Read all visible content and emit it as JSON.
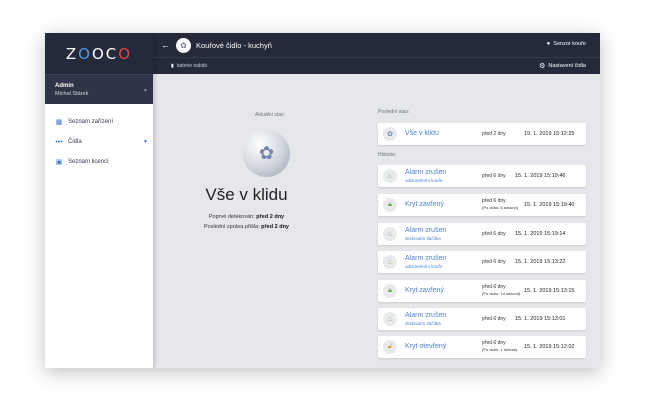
{
  "app": {
    "logo_text": "ZOOCO",
    "logo_letters": [
      "Z",
      "O",
      "O",
      "C",
      "O"
    ]
  },
  "sidebar": {
    "user": {
      "role": "Admin",
      "name": "Michal Stárek"
    },
    "items": [
      {
        "label": "Seznam zařízení",
        "icon": "grid-icon"
      },
      {
        "label": "Čidla",
        "icon": "dots-icon",
        "has_chevron": true
      },
      {
        "label": "Seznam licencí",
        "icon": "document-icon"
      }
    ]
  },
  "header": {
    "title": "Kouřové čidlo - kuchyň",
    "sensor_settings_label": "Senzor kouře",
    "battery_status": "baterie nabitá",
    "config_label": "Nastavení čidla"
  },
  "state": {
    "label": "Aktuální stav:",
    "title": "Vše v klidu",
    "first_detected_label": "Poprvé detekován:",
    "first_detected_value": "před 2 dny",
    "last_message_label": "Poslední zpráva přišla:",
    "last_message_value": "před 2 dny"
  },
  "last_state": {
    "label": "Poslední stav:",
    "title": "Vše v klidu",
    "ago": "před 2 dny",
    "timestamp": "19. 1. 2019 15:12:25"
  },
  "history": {
    "label": "Historie:",
    "items": [
      {
        "title": "Alarm zrušen",
        "subtitle": "odstraněním kouře",
        "ago": "před 6 dny",
        "ago_detail": "",
        "timestamp": "15. 1. 2019 15:19:46",
        "icon": "smoke-icon"
      },
      {
        "title": "Kryt zavřený",
        "subtitle": "",
        "ago": "před 6 dny",
        "ago_detail": "(Po dobu: 6 sekund)",
        "timestamp": "15. 1. 2019 15:19:40",
        "icon": "lock-icon"
      },
      {
        "title": "Alarm zrušen",
        "subtitle": "stisknutím tlačítka",
        "ago": "před 6 dny",
        "ago_detail": "",
        "timestamp": "15. 1. 2019 15:19:14",
        "icon": "smoke-icon"
      },
      {
        "title": "Alarm zrušen",
        "subtitle": "odstraněním kouře",
        "ago": "před 6 dny",
        "ago_detail": "",
        "timestamp": "15. 1. 2019 15:13:22",
        "icon": "smoke-icon"
      },
      {
        "title": "Kryt zavřený",
        "subtitle": "",
        "ago": "před 6 dny",
        "ago_detail": "(Po dobu: 14 sekund)",
        "timestamp": "15. 1. 2019 15:13:15",
        "icon": "lock-icon"
      },
      {
        "title": "Alarm zrušen",
        "subtitle": "stisknutím tlačítka",
        "ago": "před 6 dny",
        "ago_detail": "",
        "timestamp": "15. 1. 2019 15:13:01",
        "icon": "smoke-icon"
      },
      {
        "title": "Kryt otevřený",
        "subtitle": "",
        "ago": "před 6 dny",
        "ago_detail": "(Po dobu: 1 minuta)",
        "timestamp": "15. 1. 2019 15:12:02",
        "icon": "unlock-icon"
      }
    ]
  },
  "colors": {
    "header_bg": "#252a3a",
    "accent_blue": "#4a83d4",
    "logo_blue": "#4f9be0",
    "logo_red": "#e0463e",
    "lock_green": "#5aa83e",
    "unlock_orange": "#e0962a"
  }
}
